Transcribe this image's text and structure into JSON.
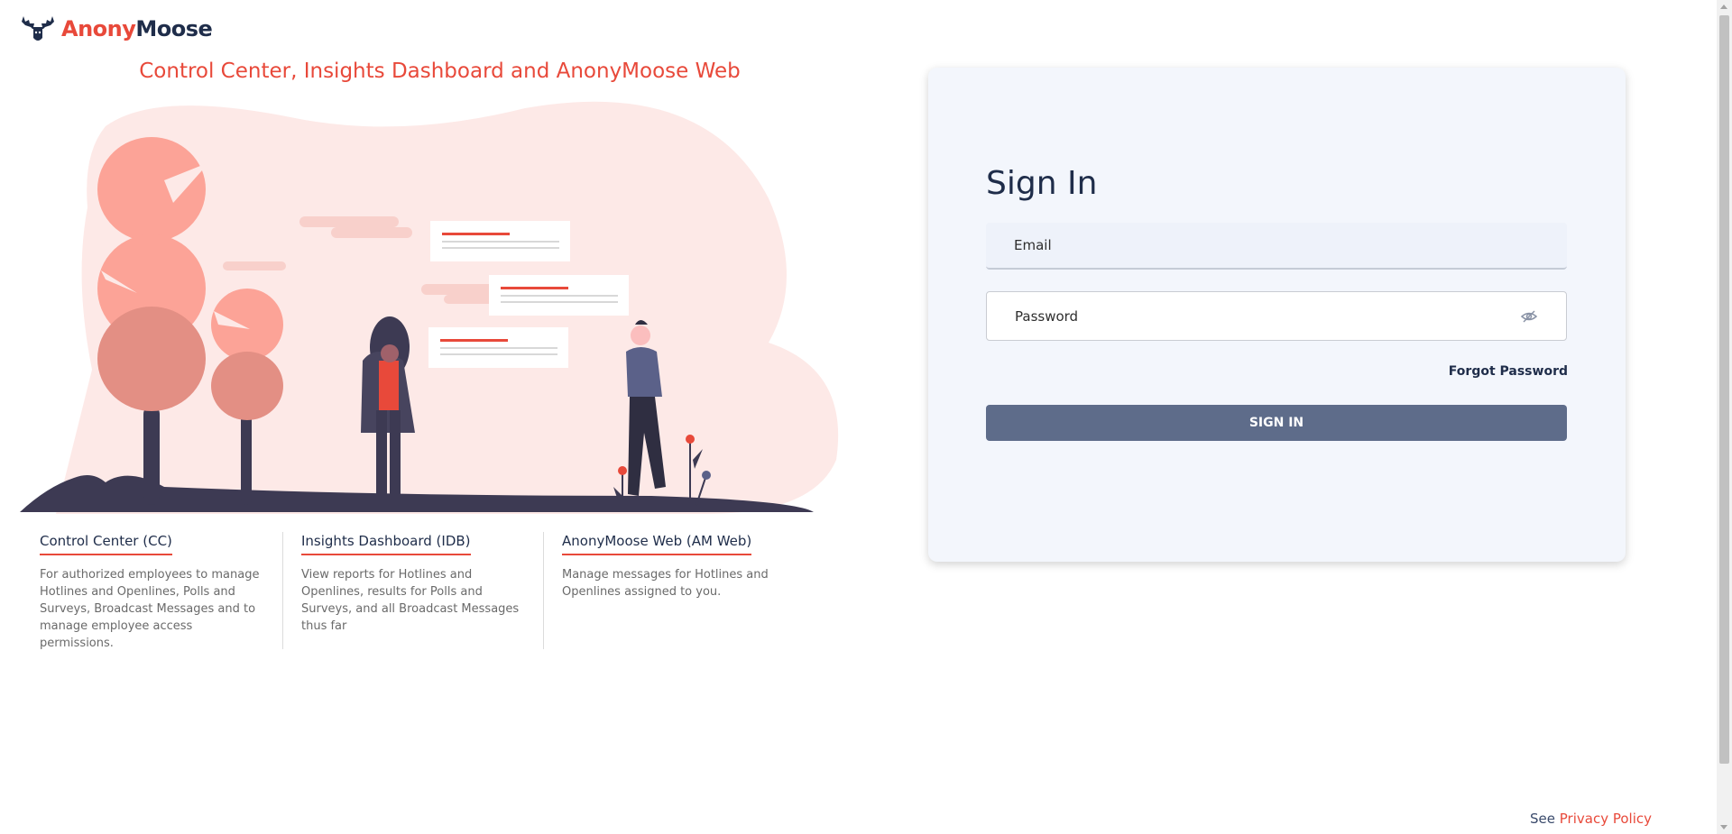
{
  "brand": {
    "name_part1": "Anony",
    "name_part2": "Moose"
  },
  "headline": "Control Center, Insights Dashboard and AnonyMoose Web",
  "products": [
    {
      "title": "Control Center (CC)",
      "description": "For authorized employees to manage Hotlines and Openlines, Polls and Surveys, Broadcast Messages and to manage employee access permissions."
    },
    {
      "title": "Insights Dashboard (IDB)",
      "description": "View reports for Hotlines and Openlines, results for Polls and Surveys, and all Broadcast Messages thus far"
    },
    {
      "title": "AnonyMoose Web (AM Web)",
      "description": "Manage messages for Hotlines and Openlines assigned to you."
    }
  ],
  "signin": {
    "title": "Sign In",
    "email_placeholder": "Email",
    "password_placeholder": "Password",
    "forgot_label": "Forgot Password",
    "button_label": "SIGN IN",
    "password_icon": "eye-slash-icon"
  },
  "footer": {
    "prefix": "See",
    "link_label": "Privacy Policy"
  },
  "colors": {
    "accent": "#e8493a",
    "navy": "#1f2d4a",
    "button": "#5e6c8a",
    "card": "#f3f6fc"
  }
}
